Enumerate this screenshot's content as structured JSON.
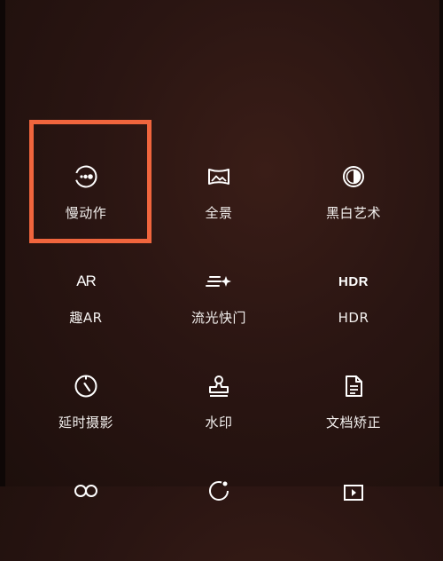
{
  "modes": [
    {
      "id": "slow-motion",
      "label": "慢动作",
      "icon": "slow-motion-icon"
    },
    {
      "id": "panorama",
      "label": "全景",
      "icon": "panorama-icon"
    },
    {
      "id": "black-white-art",
      "label": "黑白艺术",
      "icon": "half-circle-icon"
    },
    {
      "id": "fun-ar",
      "label": "趣AR",
      "icon": "ar-icon",
      "icon_text": "AR"
    },
    {
      "id": "light-painting",
      "label": "流光快门",
      "icon": "light-painting-icon"
    },
    {
      "id": "hdr",
      "label": "HDR",
      "icon": "hdr-icon",
      "icon_text": "HDR"
    },
    {
      "id": "timelapse",
      "label": "延时摄影",
      "icon": "timer-icon"
    },
    {
      "id": "watermark",
      "label": "水印",
      "icon": "stamp-icon"
    },
    {
      "id": "document-correction",
      "label": "文档矫正",
      "icon": "document-icon"
    }
  ],
  "highlight_color": "#f0653d"
}
